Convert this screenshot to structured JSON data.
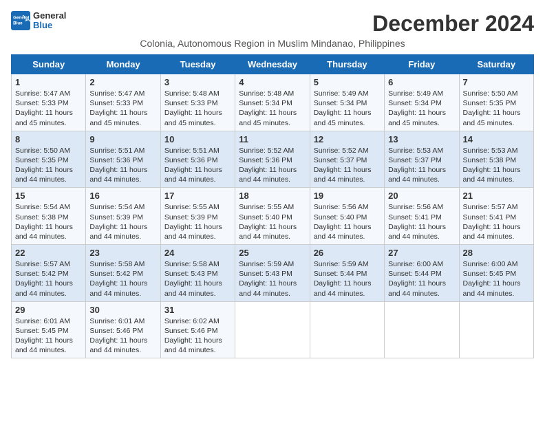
{
  "logo": {
    "line1": "General",
    "line2": "Blue"
  },
  "title": "December 2024",
  "subtitle": "Colonia, Autonomous Region in Muslim Mindanao, Philippines",
  "days_of_week": [
    "Sunday",
    "Monday",
    "Tuesday",
    "Wednesday",
    "Thursday",
    "Friday",
    "Saturday"
  ],
  "weeks": [
    [
      {
        "day": 1,
        "info": "Sunrise: 5:47 AM\nSunset: 5:33 PM\nDaylight: 11 hours\nand 45 minutes."
      },
      {
        "day": 2,
        "info": "Sunrise: 5:47 AM\nSunset: 5:33 PM\nDaylight: 11 hours\nand 45 minutes."
      },
      {
        "day": 3,
        "info": "Sunrise: 5:48 AM\nSunset: 5:33 PM\nDaylight: 11 hours\nand 45 minutes."
      },
      {
        "day": 4,
        "info": "Sunrise: 5:48 AM\nSunset: 5:34 PM\nDaylight: 11 hours\nand 45 minutes."
      },
      {
        "day": 5,
        "info": "Sunrise: 5:49 AM\nSunset: 5:34 PM\nDaylight: 11 hours\nand 45 minutes."
      },
      {
        "day": 6,
        "info": "Sunrise: 5:49 AM\nSunset: 5:34 PM\nDaylight: 11 hours\nand 45 minutes."
      },
      {
        "day": 7,
        "info": "Sunrise: 5:50 AM\nSunset: 5:35 PM\nDaylight: 11 hours\nand 45 minutes."
      }
    ],
    [
      {
        "day": 8,
        "info": "Sunrise: 5:50 AM\nSunset: 5:35 PM\nDaylight: 11 hours\nand 44 minutes."
      },
      {
        "day": 9,
        "info": "Sunrise: 5:51 AM\nSunset: 5:36 PM\nDaylight: 11 hours\nand 44 minutes."
      },
      {
        "day": 10,
        "info": "Sunrise: 5:51 AM\nSunset: 5:36 PM\nDaylight: 11 hours\nand 44 minutes."
      },
      {
        "day": 11,
        "info": "Sunrise: 5:52 AM\nSunset: 5:36 PM\nDaylight: 11 hours\nand 44 minutes."
      },
      {
        "day": 12,
        "info": "Sunrise: 5:52 AM\nSunset: 5:37 PM\nDaylight: 11 hours\nand 44 minutes."
      },
      {
        "day": 13,
        "info": "Sunrise: 5:53 AM\nSunset: 5:37 PM\nDaylight: 11 hours\nand 44 minutes."
      },
      {
        "day": 14,
        "info": "Sunrise: 5:53 AM\nSunset: 5:38 PM\nDaylight: 11 hours\nand 44 minutes."
      }
    ],
    [
      {
        "day": 15,
        "info": "Sunrise: 5:54 AM\nSunset: 5:38 PM\nDaylight: 11 hours\nand 44 minutes."
      },
      {
        "day": 16,
        "info": "Sunrise: 5:54 AM\nSunset: 5:39 PM\nDaylight: 11 hours\nand 44 minutes."
      },
      {
        "day": 17,
        "info": "Sunrise: 5:55 AM\nSunset: 5:39 PM\nDaylight: 11 hours\nand 44 minutes."
      },
      {
        "day": 18,
        "info": "Sunrise: 5:55 AM\nSunset: 5:40 PM\nDaylight: 11 hours\nand 44 minutes."
      },
      {
        "day": 19,
        "info": "Sunrise: 5:56 AM\nSunset: 5:40 PM\nDaylight: 11 hours\nand 44 minutes."
      },
      {
        "day": 20,
        "info": "Sunrise: 5:56 AM\nSunset: 5:41 PM\nDaylight: 11 hours\nand 44 minutes."
      },
      {
        "day": 21,
        "info": "Sunrise: 5:57 AM\nSunset: 5:41 PM\nDaylight: 11 hours\nand 44 minutes."
      }
    ],
    [
      {
        "day": 22,
        "info": "Sunrise: 5:57 AM\nSunset: 5:42 PM\nDaylight: 11 hours\nand 44 minutes."
      },
      {
        "day": 23,
        "info": "Sunrise: 5:58 AM\nSunset: 5:42 PM\nDaylight: 11 hours\nand 44 minutes."
      },
      {
        "day": 24,
        "info": "Sunrise: 5:58 AM\nSunset: 5:43 PM\nDaylight: 11 hours\nand 44 minutes."
      },
      {
        "day": 25,
        "info": "Sunrise: 5:59 AM\nSunset: 5:43 PM\nDaylight: 11 hours\nand 44 minutes."
      },
      {
        "day": 26,
        "info": "Sunrise: 5:59 AM\nSunset: 5:44 PM\nDaylight: 11 hours\nand 44 minutes."
      },
      {
        "day": 27,
        "info": "Sunrise: 6:00 AM\nSunset: 5:44 PM\nDaylight: 11 hours\nand 44 minutes."
      },
      {
        "day": 28,
        "info": "Sunrise: 6:00 AM\nSunset: 5:45 PM\nDaylight: 11 hours\nand 44 minutes."
      }
    ],
    [
      {
        "day": 29,
        "info": "Sunrise: 6:01 AM\nSunset: 5:45 PM\nDaylight: 11 hours\nand 44 minutes."
      },
      {
        "day": 30,
        "info": "Sunrise: 6:01 AM\nSunset: 5:46 PM\nDaylight: 11 hours\nand 44 minutes."
      },
      {
        "day": 31,
        "info": "Sunrise: 6:02 AM\nSunset: 5:46 PM\nDaylight: 11 hours\nand 44 minutes."
      },
      {
        "day": null,
        "info": ""
      },
      {
        "day": null,
        "info": ""
      },
      {
        "day": null,
        "info": ""
      },
      {
        "day": null,
        "info": ""
      }
    ]
  ]
}
